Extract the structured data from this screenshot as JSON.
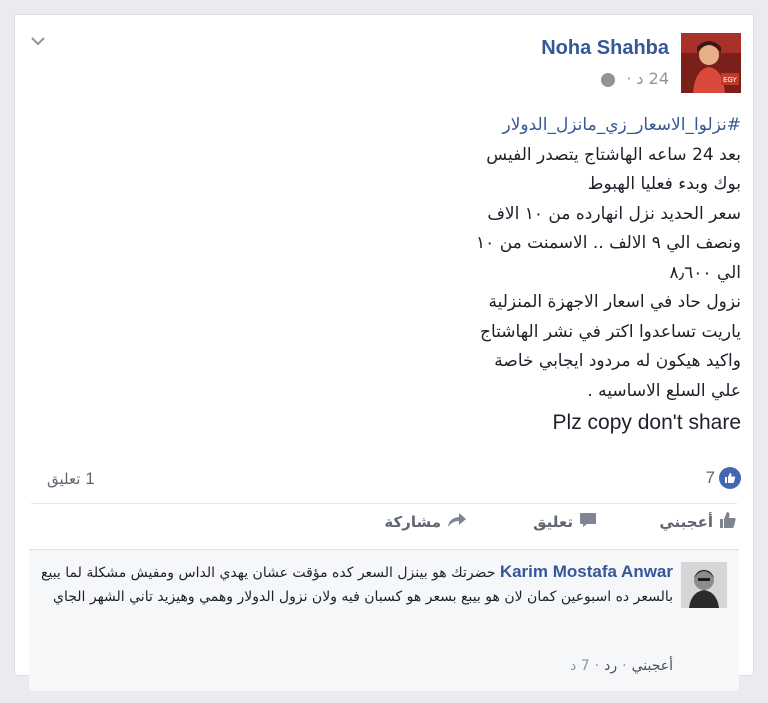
{
  "post": {
    "author": "Noha Shahba",
    "time": "24 د",
    "hashtag": "#نزلوا_الاسعار_زي_مانزل_الدولار",
    "lines": [
      "بعد 24 ساعه الهاشتاج يتصدر الفيس",
      "بوك وبدء فعليا الهبوط",
      "سعر الحديد نزل انهارده من ١٠ الاف",
      "ونصف الي ٩ الالف .. الاسمنت من ١٠",
      "الي ٨٫٦٠٠",
      "نزول حاد في اسعار الاجهزة المنزلية",
      "ياريت تساعدوا اكتر في نشر الهاشتاج",
      "واكيد هيكون له مردود ايجابي خاصة",
      "علي السلع الاساسيه ."
    ],
    "plz": "Plz copy don't share",
    "avatar_badge": "EGY"
  },
  "counts": {
    "likes": "7",
    "comments_num": "1",
    "comments_label": "تعليق"
  },
  "actions": {
    "like": "أعجبني",
    "comment": "تعليق",
    "share": "مشاركة"
  },
  "comment": {
    "name": "Karim Mostafa Anwar",
    "text": "حضرتك هو بينزل السعر كده مؤقت عشان يهدي الداس ومفيش مشكلة لما يبيع بالسعر ده اسبوعين كمان لان هو بيبع بسعر هو كسبان فيه ولان نزول الدولار وهمي وهيزيد تاني الشهر الجاي",
    "like": "أعجبني",
    "reply": "رد",
    "time": "7 د"
  },
  "colors": {
    "link": "#365899",
    "like_badge": "#4267b2",
    "meta": "#90949c"
  },
  "icons": [
    "chevron-down-icon",
    "globe-icon",
    "like-badge-icon",
    "thumbs-up-icon",
    "comment-icon",
    "share-icon"
  ]
}
